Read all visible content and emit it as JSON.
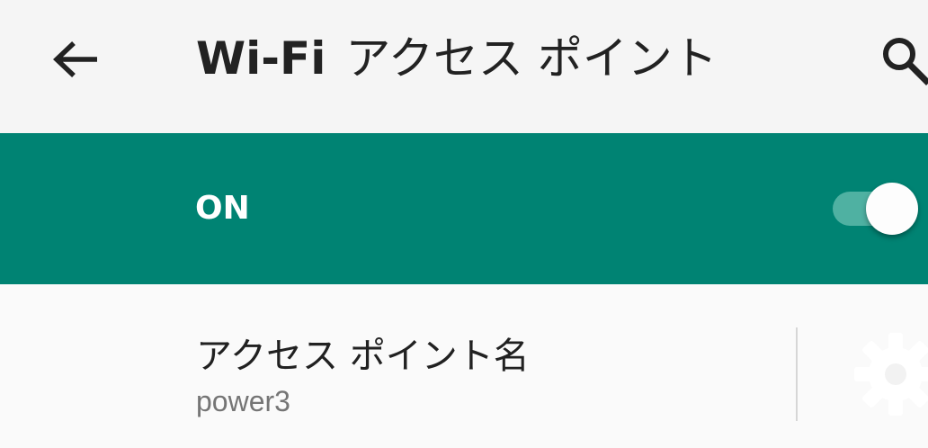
{
  "app_bar": {
    "back_icon": "arrow-back-icon",
    "title_primary": "Wi-Fi",
    "title_secondary": "アクセス ポイント",
    "search_icon": "search-icon"
  },
  "master_switch": {
    "label": "ON",
    "state": true,
    "bar_color": "#008373",
    "track_color": "#4fb1a2",
    "thumb_color": "#fdfdfd"
  },
  "preference": {
    "title": "アクセス ポイント名",
    "summary": "power3",
    "settings_icon": "settings-icon"
  }
}
